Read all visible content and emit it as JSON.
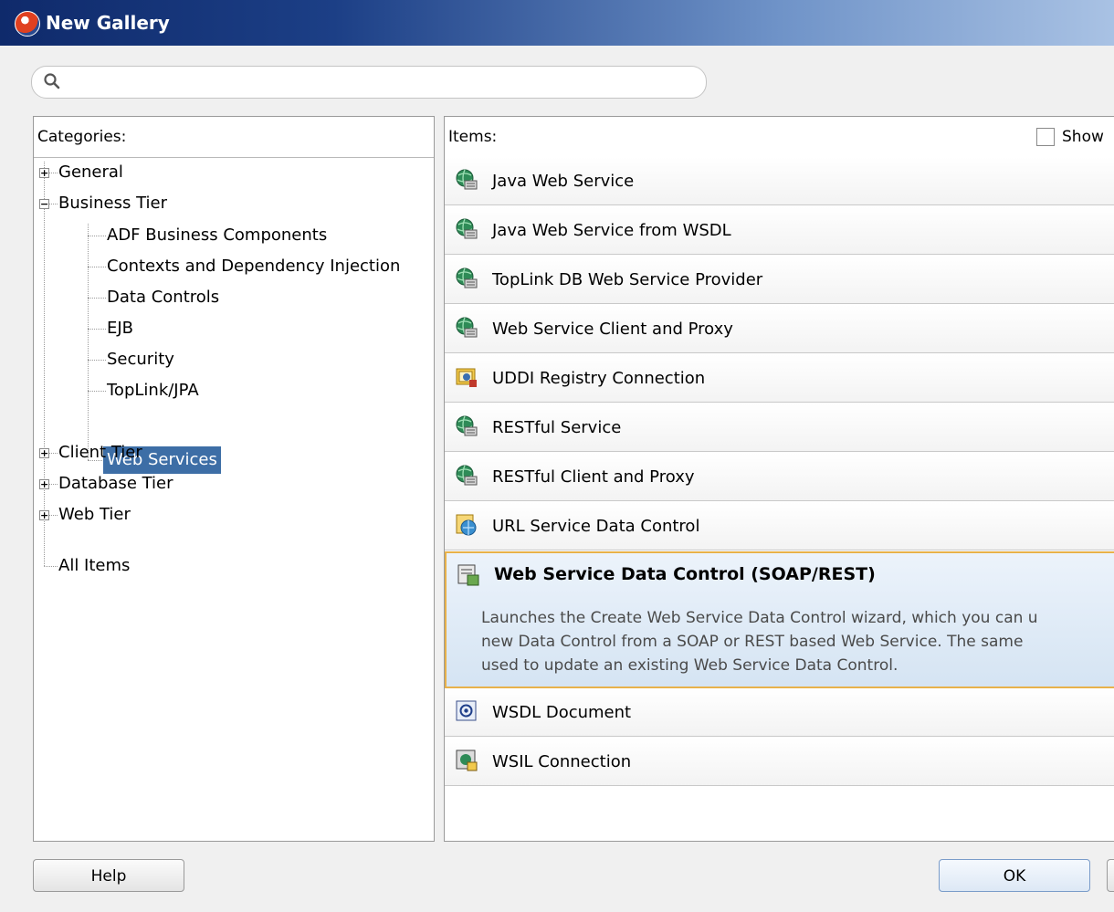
{
  "window": {
    "title": "New Gallery"
  },
  "search": {
    "placeholder": ""
  },
  "categories": {
    "header": "Categories:",
    "tree": [
      {
        "label": "General"
      },
      {
        "label": "Business Tier"
      },
      {
        "label": "ADF Business Components"
      },
      {
        "label": "Contexts and Dependency Injection"
      },
      {
        "label": "Data Controls"
      },
      {
        "label": "EJB"
      },
      {
        "label": "Security"
      },
      {
        "label": "TopLink/JPA"
      },
      {
        "label": "Web Services"
      },
      {
        "label": "Client Tier"
      },
      {
        "label": "Database Tier"
      },
      {
        "label": "Web Tier"
      },
      {
        "label": "All Items"
      }
    ]
  },
  "items": {
    "header": "Items:",
    "show_label": "Show",
    "list": [
      {
        "label": "Java Web Service",
        "icon": "globe-service-icon"
      },
      {
        "label": "Java Web Service from WSDL",
        "icon": "globe-service-icon"
      },
      {
        "label": "TopLink DB Web Service Provider",
        "icon": "globe-service-icon"
      },
      {
        "label": "Web Service Client and Proxy",
        "icon": "globe-service-icon"
      },
      {
        "label": "UDDI Registry Connection",
        "icon": "uddi-registry-icon"
      },
      {
        "label": "RESTful Service",
        "icon": "globe-service-icon"
      },
      {
        "label": "RESTful Client and Proxy",
        "icon": "globe-service-icon"
      },
      {
        "label": "URL Service Data Control",
        "icon": "url-data-control-icon"
      },
      {
        "label": "Web Service Data Control (SOAP/REST)",
        "icon": "ws-data-control-icon",
        "description": "Launches the Create Web Service Data Control wizard, which you can u\nnew Data Control from a SOAP or REST based Web Service. The same\nused to update an existing Web Service Data Control."
      },
      {
        "label": "WSDL Document",
        "icon": "wsdl-document-icon"
      },
      {
        "label": "WSIL Connection",
        "icon": "wsil-connection-icon"
      }
    ]
  },
  "buttons": {
    "help": "Help",
    "ok": "OK"
  }
}
